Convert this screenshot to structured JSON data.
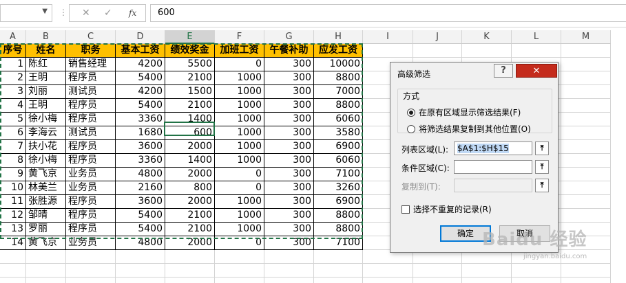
{
  "formula_bar": {
    "name_box": "",
    "cancel_icon": "✕",
    "enter_icon": "✓",
    "fx_label": "fx",
    "value": "600"
  },
  "columns": [
    "A",
    "B",
    "C",
    "D",
    "E",
    "F",
    "G",
    "H",
    "I",
    "J",
    "K",
    "L",
    "M"
  ],
  "selected_column": "E",
  "table": {
    "headers": [
      "序号",
      "姓名",
      "职务",
      "基本工资",
      "绩效奖金",
      "加班工资",
      "午餐补助",
      "应发工资"
    ],
    "rows": [
      [
        "1",
        "陈红",
        "销售经理",
        "4200",
        "5500",
        "0",
        "300",
        "10000"
      ],
      [
        "2",
        "王明",
        "程序员",
        "5400",
        "2100",
        "1000",
        "300",
        "8800"
      ],
      [
        "3",
        "刘丽",
        "测试员",
        "4200",
        "1500",
        "1000",
        "300",
        "7000"
      ],
      [
        "4",
        "王明",
        "程序员",
        "5400",
        "2100",
        "1000",
        "300",
        "8800"
      ],
      [
        "5",
        "徐小梅",
        "程序员",
        "3360",
        "1400",
        "1000",
        "300",
        "6060"
      ],
      [
        "6",
        "李海云",
        "测试员",
        "1680",
        "600",
        "1000",
        "300",
        "3580"
      ],
      [
        "7",
        "扶小花",
        "程序员",
        "3600",
        "2000",
        "1000",
        "300",
        "6900"
      ],
      [
        "8",
        "徐小梅",
        "程序员",
        "3360",
        "1400",
        "1000",
        "300",
        "6060"
      ],
      [
        "9",
        "黄飞京",
        "业务员",
        "4800",
        "2000",
        "0",
        "300",
        "7100"
      ],
      [
        "10",
        "林美兰",
        "业务员",
        "2160",
        "800",
        "0",
        "300",
        "3260"
      ],
      [
        "11",
        "张胜源",
        "程序员",
        "3600",
        "2000",
        "1000",
        "300",
        "6900"
      ],
      [
        "12",
        "邹晴",
        "程序员",
        "5400",
        "2100",
        "1000",
        "300",
        "8800"
      ],
      [
        "13",
        "罗丽",
        "程序员",
        "5400",
        "2100",
        "1000",
        "300",
        "8800"
      ],
      [
        "14",
        "黄飞京",
        "业务员",
        "4800",
        "2000",
        "0",
        "300",
        "7100"
      ]
    ]
  },
  "dialog": {
    "title": "高级筛选",
    "help_label": "?",
    "close_label": "✕",
    "group_label": "方式",
    "option_in_place": "在原有区域显示筛选结果(F)",
    "option_copy": "将筛选结果复制到其他位置(O)",
    "list_range_label": "列表区域(L):",
    "list_range_value": "$A$1:$H$15",
    "criteria_range_label": "条件区域(C):",
    "criteria_range_value": "",
    "copy_to_label": "复制到(T):",
    "copy_to_value": "",
    "collapse_icon": "⤒",
    "unique_label": "选择不重复的记录(R)",
    "ok_label": "确定",
    "cancel_label": "取消"
  },
  "watermark": {
    "text": "Baidu 经验",
    "sub": "jingyan.baidu.com"
  }
}
